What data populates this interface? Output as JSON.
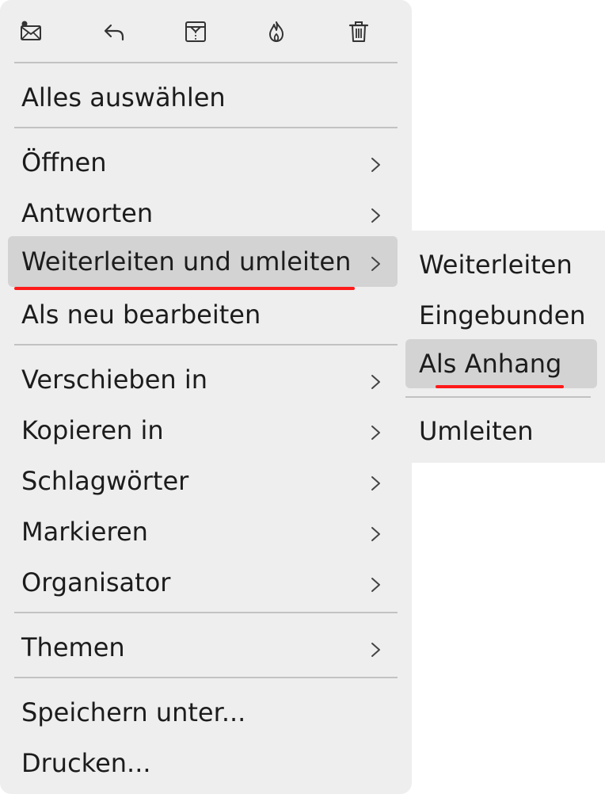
{
  "toolbar": {
    "buttons": [
      {
        "icon": "mark-as-read-icon"
      },
      {
        "icon": "reply-icon"
      },
      {
        "icon": "archive-icon"
      },
      {
        "icon": "junk-icon"
      },
      {
        "icon": "trash-icon"
      }
    ]
  },
  "menu": {
    "select_all": "Alles auswählen",
    "items": [
      {
        "label": "Öffnen",
        "submenu": true
      },
      {
        "label": "Antworten",
        "submenu": true
      },
      {
        "label": "Weiterleiten und umleiten",
        "submenu": true,
        "highlighted": true
      },
      {
        "label": "Als neu bearbeiten",
        "submenu": false
      },
      {
        "label": "Verschieben in",
        "submenu": true
      },
      {
        "label": "Kopieren in",
        "submenu": true
      },
      {
        "label": "Schlagwörter",
        "submenu": true
      },
      {
        "label": "Markieren",
        "submenu": true
      },
      {
        "label": "Organisator",
        "submenu": true
      },
      {
        "label": "Themen",
        "submenu": true
      },
      {
        "label": "Speichern unter...",
        "submenu": false
      },
      {
        "label": "Drucken...",
        "submenu": false
      }
    ]
  },
  "submenu": {
    "items": [
      {
        "label": "Weiterleiten"
      },
      {
        "label": "Eingebunden"
      },
      {
        "label": "Als Anhang",
        "highlighted": true
      },
      {
        "label": "Umleiten"
      }
    ]
  },
  "colors": {
    "menu_background": "#eeeeee",
    "highlight": "#d3d3d3",
    "annotation_underline": "#ff1a1a",
    "text": "#1c1c1c"
  }
}
